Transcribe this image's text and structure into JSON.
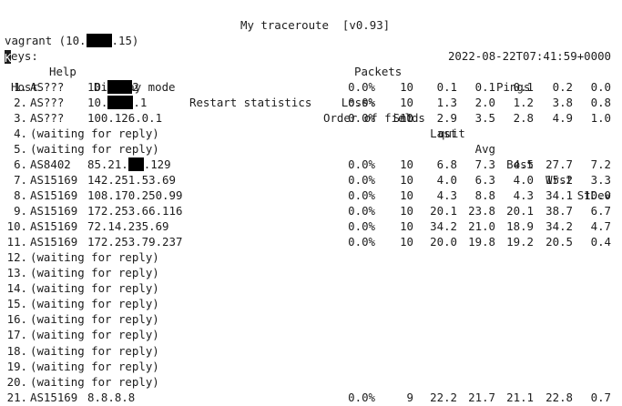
{
  "title": "My traceroute  [v0.93]",
  "host": {
    "left": "vagrant (10.",
    "right": ".15)"
  },
  "datetime": "2022-08-22T07:41:59+0000",
  "menu": {
    "cursor_char": "K",
    "keys_rest": "eys:",
    "items": [
      "Help",
      "Display mode",
      "Restart statistics",
      "Order of fields",
      "quit"
    ]
  },
  "headers": {
    "packets": "Packets",
    "pings": "Pings",
    "host": "Host",
    "cols": [
      "Loss%",
      "Snt",
      "Last",
      "Avg",
      "Best",
      "Wrst",
      "StDev"
    ]
  },
  "rows": [
    {
      "num": "1.",
      "asn": "AS???",
      "ip_a": "10.",
      "ip_b": "2",
      "stats": [
        "0.0%",
        "10",
        "0.1",
        "0.1",
        "0.1",
        "0.2",
        "0.0"
      ]
    },
    {
      "num": "2.",
      "asn": "AS???",
      "ip_a": "10.",
      "ip_b": ".1",
      "stats": [
        "0.0%",
        "10",
        "1.3",
        "2.0",
        "1.2",
        "3.8",
        "0.8"
      ]
    },
    {
      "num": "3.",
      "asn": "AS???",
      "ip": "100.126.0.1",
      "stats": [
        "0.0%",
        "10",
        "2.9",
        "3.5",
        "2.8",
        "4.9",
        "1.0"
      ]
    },
    {
      "num": "4.",
      "waiting": "(waiting for reply)"
    },
    {
      "num": "5.",
      "waiting": "(waiting for reply)"
    },
    {
      "num": "6.",
      "asn": "AS8402",
      "ip_a": "85.21.",
      "ip_b": ".129",
      "stats": [
        "0.0%",
        "10",
        "6.8",
        "7.3",
        "4.5",
        "27.7",
        "7.2"
      ]
    },
    {
      "num": "7.",
      "asn": "AS15169",
      "ip": "142.251.53.69",
      "stats": [
        "0.0%",
        "10",
        "4.0",
        "6.3",
        "4.0",
        "15.2",
        "3.3"
      ]
    },
    {
      "num": "8.",
      "asn": "AS15169",
      "ip": "108.170.250.99",
      "stats": [
        "0.0%",
        "10",
        "4.3",
        "8.8",
        "4.3",
        "34.1",
        "10.0"
      ]
    },
    {
      "num": "9.",
      "asn": "AS15169",
      "ip": "172.253.66.116",
      "stats": [
        "0.0%",
        "10",
        "20.1",
        "23.8",
        "20.1",
        "38.7",
        "6.7"
      ]
    },
    {
      "num": "10.",
      "asn": "AS15169",
      "ip": "72.14.235.69",
      "stats": [
        "0.0%",
        "10",
        "34.2",
        "21.0",
        "18.9",
        "34.2",
        "4.7"
      ]
    },
    {
      "num": "11.",
      "asn": "AS15169",
      "ip": "172.253.79.237",
      "stats": [
        "0.0%",
        "10",
        "20.0",
        "19.8",
        "19.2",
        "20.5",
        "0.4"
      ]
    },
    {
      "num": "12.",
      "waiting": "(waiting for reply)"
    },
    {
      "num": "13.",
      "waiting": "(waiting for reply)"
    },
    {
      "num": "14.",
      "waiting": "(waiting for reply)"
    },
    {
      "num": "15.",
      "waiting": "(waiting for reply)"
    },
    {
      "num": "16.",
      "waiting": "(waiting for reply)"
    },
    {
      "num": "17.",
      "waiting": "(waiting for reply)"
    },
    {
      "num": "18.",
      "waiting": "(waiting for reply)"
    },
    {
      "num": "19.",
      "waiting": "(waiting for reply)"
    },
    {
      "num": "20.",
      "waiting": "(waiting for reply)"
    },
    {
      "num": "21.",
      "asn": "AS15169",
      "ip": "8.8.8.8",
      "stats": [
        "0.0%",
        "9",
        "22.2",
        "21.7",
        "21.1",
        "22.8",
        "0.7"
      ]
    }
  ]
}
